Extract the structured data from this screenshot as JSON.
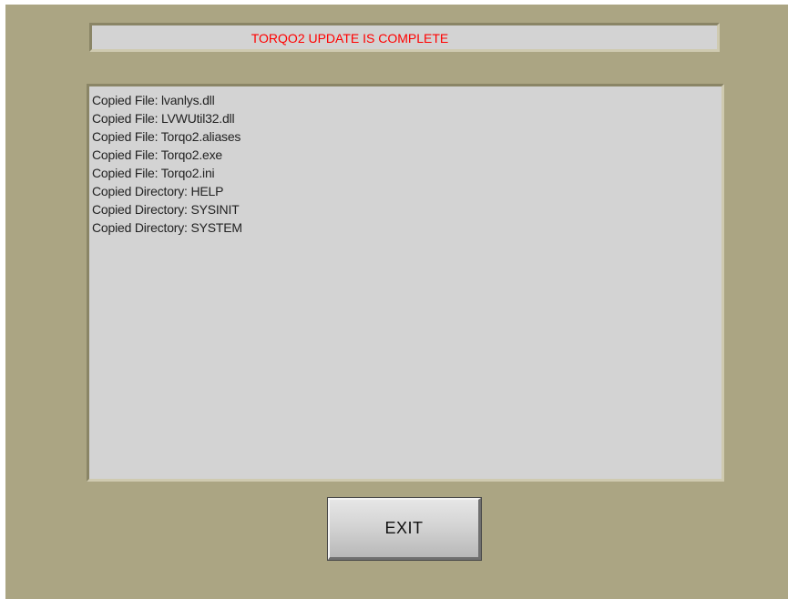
{
  "status": {
    "message": "TORQO2 UPDATE IS COMPLETE",
    "color": "#ff0000"
  },
  "log": {
    "lines": [
      "Copied File: lvanlys.dll",
      "Copied File: LVWUtil32.dll",
      "Copied File: Torqo2.aliases",
      "Copied File: Torqo2.exe",
      "Copied File: Torqo2.ini",
      "Copied Directory: HELP",
      "Copied Directory: SYSINIT",
      "Copied Directory: SYSTEM"
    ]
  },
  "actions": {
    "exit_label": "EXIT"
  },
  "colors": {
    "window_background": "#aba583",
    "panel_background": "#d3d3d3"
  }
}
